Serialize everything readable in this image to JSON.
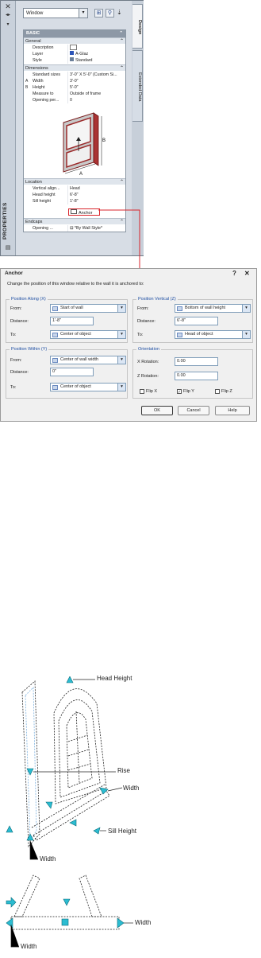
{
  "palette": {
    "title": "PROPERTIES",
    "type_selector": "Window",
    "tabs": [
      "Design",
      "Extended Data"
    ],
    "basic_header": "BASIC",
    "categories": {
      "general": "General",
      "dimensions": "Dimensions",
      "location": "Location",
      "endcaps": "Endcaps"
    },
    "general_rows": [
      {
        "label": "Description",
        "value": ""
      },
      {
        "label": "Layer",
        "value": "A-Glaz"
      },
      {
        "label": "Style",
        "value": "Standard"
      }
    ],
    "dimension_rows": [
      {
        "marker": "",
        "label": "Standard sizes",
        "value": "3'-0\" X 5'-0\" (Custom Si..."
      },
      {
        "marker": "A",
        "label": "Width",
        "value": "3'-0\""
      },
      {
        "marker": "B",
        "label": "Height",
        "value": "5'-0\""
      },
      {
        "marker": "",
        "label": "Measure to",
        "value": "Outside of frame"
      },
      {
        "marker": "",
        "label": "Opening per...",
        "value": "0"
      }
    ],
    "location_rows": [
      {
        "label": "Vertical align...",
        "value": "Head"
      },
      {
        "label": "Head height",
        "value": "6'-8\""
      },
      {
        "label": "Sill height",
        "value": "1'-8\""
      }
    ],
    "anchor_value": "Anchor",
    "endcap_row": {
      "label": "Opening ...",
      "value": "*By Wall Style*"
    },
    "diagram_labels": [
      "A",
      "B"
    ]
  },
  "dialog": {
    "title": "Anchor",
    "description": "Change the position of this window relative to the wall it is anchored to:",
    "along": {
      "title": "Position Along (X)",
      "from_label": "From:",
      "from": "Start of wall",
      "distance_label": "Distance:",
      "distance": "1'-8\"",
      "to_label": "To:",
      "to": "Center of object"
    },
    "vertical": {
      "title": "Position Vertical (Z)",
      "from_label": "From:",
      "from": "Bottom of wall height",
      "distance_label": "Distance:",
      "distance": "6'-8\"",
      "to_label": "To:",
      "to": "Head of object"
    },
    "within": {
      "title": "Position Within (Y)",
      "from_label": "From:",
      "from": "Center of wall width",
      "distance_label": "Distance:",
      "distance": "0\"",
      "to_label": "To:",
      "to": "Center of object"
    },
    "orientation": {
      "title": "Orientation",
      "x_label": "X Rotation:",
      "x_value": "0.00",
      "z_label": "Z Rotation:",
      "z_value": "0.00",
      "flip_x": "Flip X",
      "flip_y": "Flip Y",
      "flip_z": "Flip Z",
      "flip_x_checked": false,
      "flip_y_checked": true,
      "flip_z_checked": false
    },
    "buttons": {
      "ok": "OK",
      "cancel": "Cancel",
      "help": "Help"
    }
  },
  "illustration": {
    "labels": {
      "head_height": "Head Height",
      "rise": "Rise",
      "width_right": "Width",
      "sill_height": "Sill Height",
      "width_bottom": "Width"
    },
    "plan_labels": {
      "width_right": "Width",
      "width_bottom": "Width"
    }
  },
  "colors": {
    "grip": "#2bbcd1",
    "highlight": "#d9262c",
    "accent": "#1f4fa3"
  }
}
